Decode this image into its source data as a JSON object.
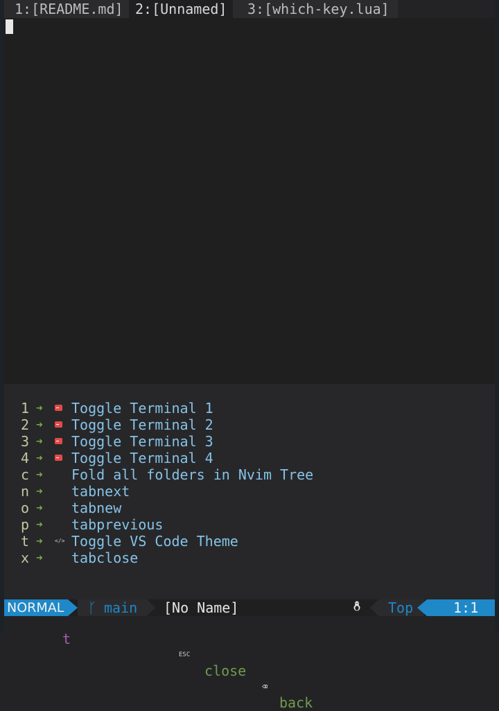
{
  "tabline": {
    "tabs": [
      {
        "label": "1:[README.md]",
        "active": false
      },
      {
        "label": "2:[Unnamed]",
        "active": true
      },
      {
        "label": "3:[which-key.lua]",
        "active": false
      }
    ]
  },
  "which_key": {
    "items": [
      {
        "key": "1",
        "icon": "terminal-icon",
        "desc": "Toggle Terminal 1"
      },
      {
        "key": "2",
        "icon": "terminal-icon",
        "desc": "Toggle Terminal 2"
      },
      {
        "key": "3",
        "icon": "terminal-icon",
        "desc": "Toggle Terminal 3"
      },
      {
        "key": "4",
        "icon": "terminal-icon",
        "desc": "Toggle Terminal 4"
      },
      {
        "key": "c",
        "icon": "",
        "desc": "Fold all folders in Nvim Tree"
      },
      {
        "key": "n",
        "icon": "",
        "desc": "tabnext"
      },
      {
        "key": "o",
        "icon": "",
        "desc": "tabnew"
      },
      {
        "key": "p",
        "icon": "",
        "desc": "tabprevious"
      },
      {
        "key": "t",
        "icon": "code-icon",
        "desc": "Toggle VS Code Theme"
      },
      {
        "key": "x",
        "icon": "",
        "desc": "tabclose"
      }
    ],
    "footer": {
      "leader": "␣",
      "crumb_separator": "»",
      "prefix": "t",
      "esc_key": "ESC",
      "close_label": "close",
      "backspace_key": "⌫",
      "back_label": "back"
    }
  },
  "statusline": {
    "mode": "NORMAL",
    "branch_icon": "ᚴ",
    "branch": "main",
    "filename": "[No Name]",
    "os_icon": "linux-icon",
    "position": "Top",
    "line_col": "1:1"
  },
  "colors": {
    "accent": "#1e88c8",
    "key": "#c5c5a0",
    "arrow": "#7fa84e",
    "description": "#86c3e6",
    "terminal_icon": "#e24a4a",
    "footer_green": "#6f9c4a",
    "footer_purple": "#a65ea8"
  }
}
